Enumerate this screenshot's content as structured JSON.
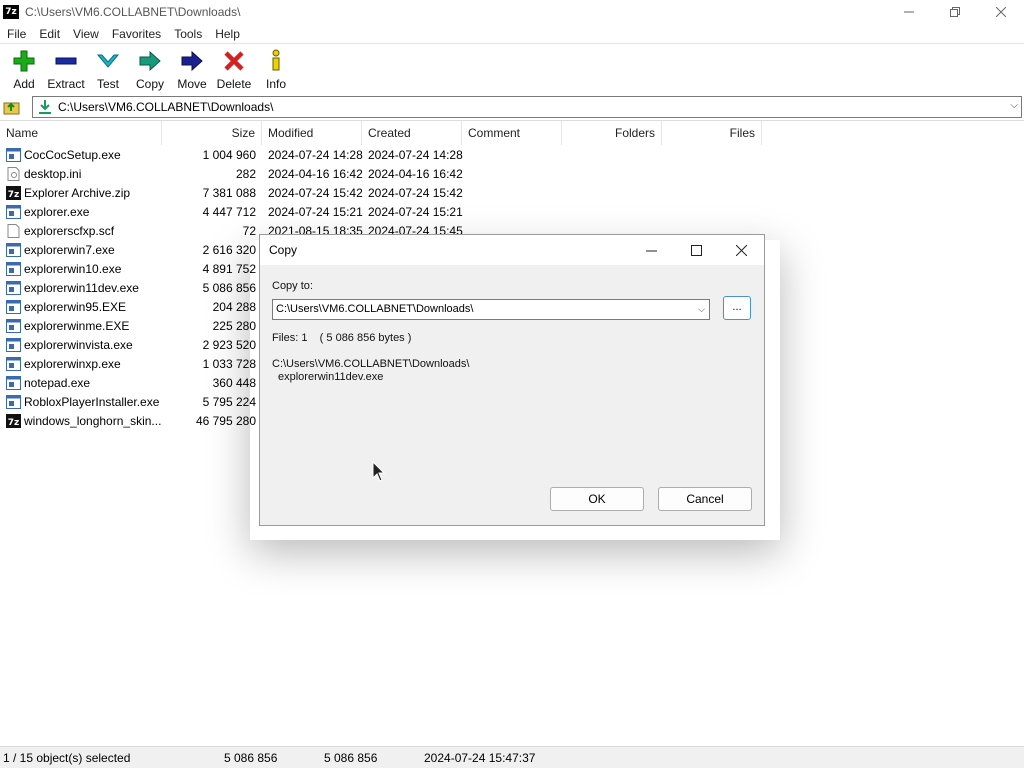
{
  "window": {
    "app_icon_text": "7z",
    "title": "C:\\Users\\VM6.COLLABNET\\Downloads\\"
  },
  "menu": [
    "File",
    "Edit",
    "View",
    "Favorites",
    "Tools",
    "Help"
  ],
  "toolbar": [
    {
      "label": "Add",
      "icon": "add-icon",
      "color": "#1aaa1a"
    },
    {
      "label": "Extract",
      "icon": "extract-icon",
      "color": "#1a2aa0"
    },
    {
      "label": "Test",
      "icon": "test-icon",
      "color": "#1ab4c4"
    },
    {
      "label": "Copy",
      "icon": "copy-icon",
      "color": "#1a9a7a"
    },
    {
      "label": "Move",
      "icon": "move-icon",
      "color": "#1a2090"
    },
    {
      "label": "Delete",
      "icon": "delete-icon",
      "color": "#d42020"
    },
    {
      "label": "Info",
      "icon": "info-icon",
      "color": "#c8b400"
    }
  ],
  "address": {
    "path": "C:\\Users\\VM6.COLLABNET\\Downloads\\"
  },
  "columns": {
    "name": "Name",
    "size": "Size",
    "modified": "Modified",
    "created": "Created",
    "comment": "Comment",
    "folders": "Folders",
    "files": "Files"
  },
  "files": [
    {
      "name": "CocCocSetup.exe",
      "size": "1 004 960",
      "modified": "2024-07-24 14:28",
      "created": "2024-07-24 14:28",
      "icon": "exe"
    },
    {
      "name": "desktop.ini",
      "size": "282",
      "modified": "2024-04-16 16:42",
      "created": "2024-04-16 16:42",
      "icon": "ini"
    },
    {
      "name": "Explorer Archive.zip",
      "size": "7 381 088",
      "modified": "2024-07-24 15:42",
      "created": "2024-07-24 15:42",
      "icon": "7z"
    },
    {
      "name": "explorer.exe",
      "size": "4 447 712",
      "modified": "2024-07-24 15:21",
      "created": "2024-07-24 15:21",
      "icon": "exe"
    },
    {
      "name": "explorerscfxp.scf",
      "size": "72",
      "modified": "2021-08-15 18:35",
      "created": "2024-07-24 15:45",
      "icon": "file"
    },
    {
      "name": "explorerwin7.exe",
      "size": "2 616 320",
      "modified": "",
      "created": "",
      "icon": "exe"
    },
    {
      "name": "explorerwin10.exe",
      "size": "4 891 752",
      "modified": "",
      "created": "",
      "icon": "exe"
    },
    {
      "name": "explorerwin11dev.exe",
      "size": "5 086 856",
      "modified": "",
      "created": "",
      "icon": "exe"
    },
    {
      "name": "explorerwin95.EXE",
      "size": "204 288",
      "modified": "",
      "created": "",
      "icon": "exe"
    },
    {
      "name": "explorerwinme.EXE",
      "size": "225 280",
      "modified": "",
      "created": "",
      "icon": "exe"
    },
    {
      "name": "explorerwinvista.exe",
      "size": "2 923 520",
      "modified": "",
      "created": "",
      "icon": "exe"
    },
    {
      "name": "explorerwinxp.exe",
      "size": "1 033 728",
      "modified": "",
      "created": "",
      "icon": "exe"
    },
    {
      "name": "notepad.exe",
      "size": "360 448",
      "modified": "",
      "created": "",
      "icon": "exe"
    },
    {
      "name": "RobloxPlayerInstaller.exe",
      "size": "5 795 224",
      "modified": "",
      "created": "",
      "icon": "exe"
    },
    {
      "name": "windows_longhorn_skin...",
      "size": "46 795 280",
      "modified": "",
      "created": "",
      "icon": "7z"
    }
  ],
  "status": {
    "selected": "1 / 15 object(s) selected",
    "size1": "5 086 856",
    "size2": "5 086 856",
    "datetime": "2024-07-24 15:47:37"
  },
  "dialog": {
    "title": "Copy",
    "copy_to_label": "Copy to:",
    "destination": "C:\\Users\\VM6.COLLABNET\\Downloads\\",
    "browse_label": "...",
    "files_info": "Files: 1    ( 5 086 856 bytes )",
    "source_path": "C:\\Users\\VM6.COLLABNET\\Downloads\\",
    "source_file": "explorerwin11dev.exe",
    "ok": "OK",
    "cancel": "Cancel"
  }
}
